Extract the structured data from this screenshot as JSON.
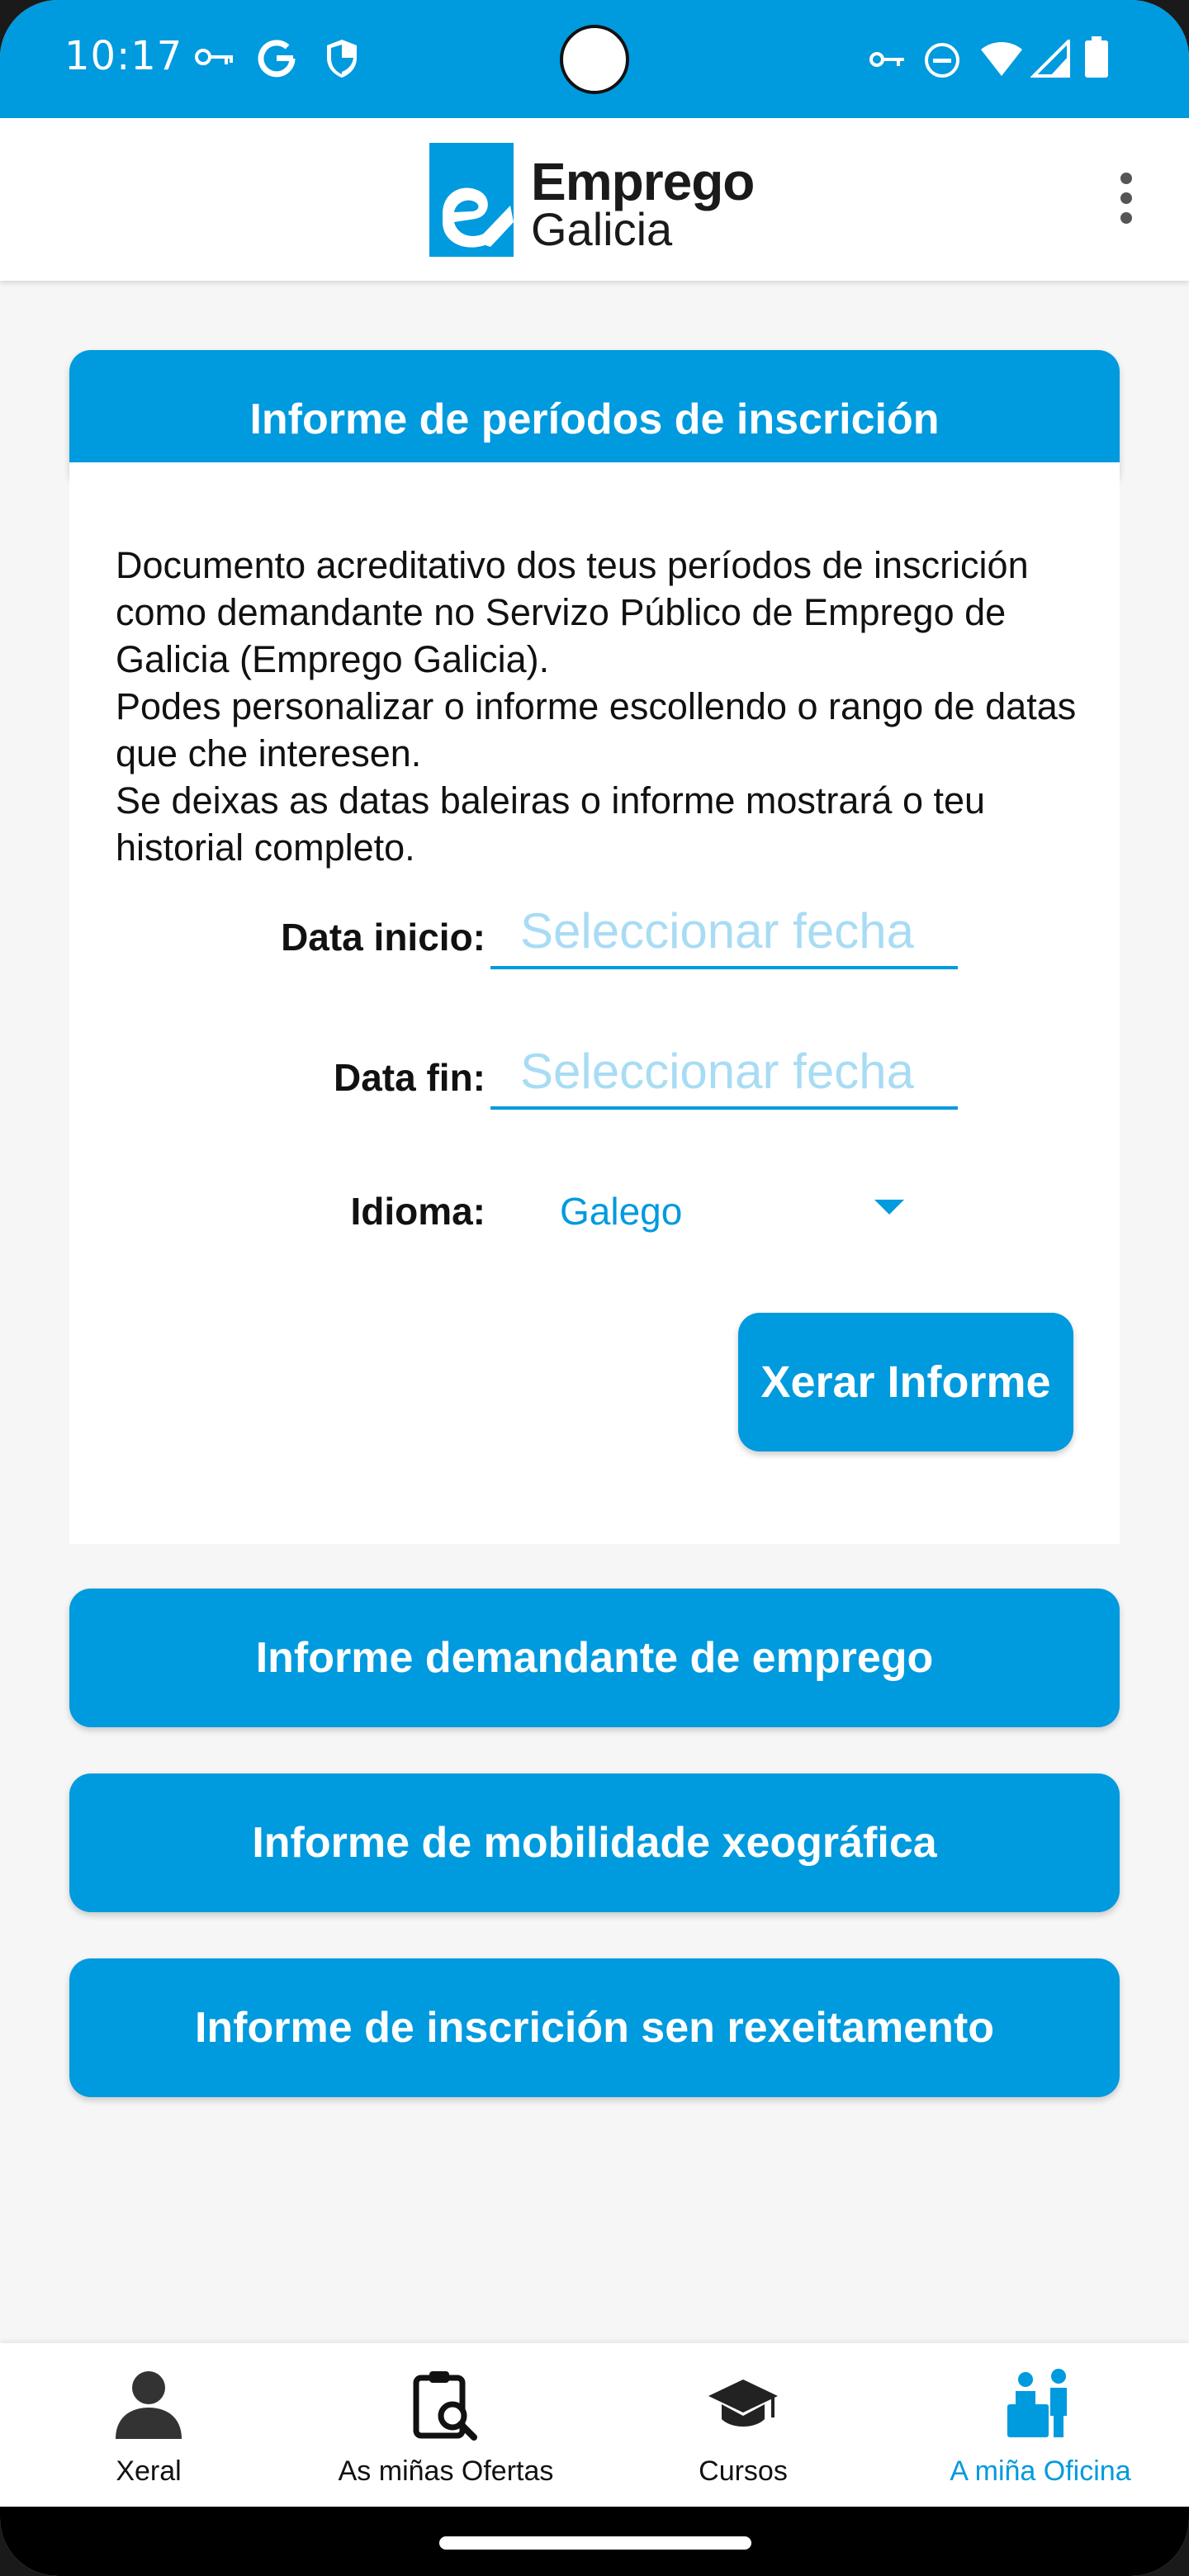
{
  "status_bar": {
    "time": "10:17",
    "colors": {
      "background": "#009ade",
      "foreground": "#ffffff"
    },
    "left_icons": [
      "vpn-key-icon",
      "google-icon",
      "shield-icon"
    ],
    "right_icons": [
      "vpn-key-icon",
      "do-not-disturb-icon",
      "wifi-icon",
      "signal-icon",
      "battery-icon"
    ]
  },
  "header": {
    "logo_line1": "Emprego",
    "logo_line2": "Galicia",
    "menu_icon": "more-vert-icon"
  },
  "sections": {
    "periods": {
      "title": "Informe de períodos de inscrición",
      "description": [
        "Documento acreditativo dos teus períodos de inscrición como demandante no Servizo Público de Emprego de Galicia (Emprego Galicia).",
        "Podes personalizar o informe escollendo o rango de datas que che interesen.",
        "Se deixas as datas baleiras o informe mostrará o teu historial completo."
      ],
      "start_label": "Data inicio:",
      "start_placeholder": "Seleccionar fecha",
      "end_label": "Data fin:",
      "end_placeholder": "Seleccionar fecha",
      "language_label": "Idioma:",
      "language_value": "Galego",
      "generate_button": "Xerar Informe"
    },
    "jobseeker": {
      "title": "Informe demandante de emprego"
    },
    "mobility": {
      "title": "Informe de mobilidade xeográfica"
    },
    "no_rejection": {
      "title": "Informe de inscrición sen rexeitamento"
    }
  },
  "bottom_nav": {
    "items": [
      {
        "label": "Xeral",
        "icon": "person-icon",
        "active": false
      },
      {
        "label": "As miñas Ofertas",
        "icon": "clipboard-search-icon",
        "active": false
      },
      {
        "label": "Cursos",
        "icon": "graduation-cap-icon",
        "active": false
      },
      {
        "label": "A miña Oficina",
        "icon": "office-people-icon",
        "active": true
      }
    ],
    "active_color": "#009ade"
  },
  "colors": {
    "accent": "#009ade",
    "placeholder": "#a8dcf4",
    "background": "#f6f6f6"
  }
}
